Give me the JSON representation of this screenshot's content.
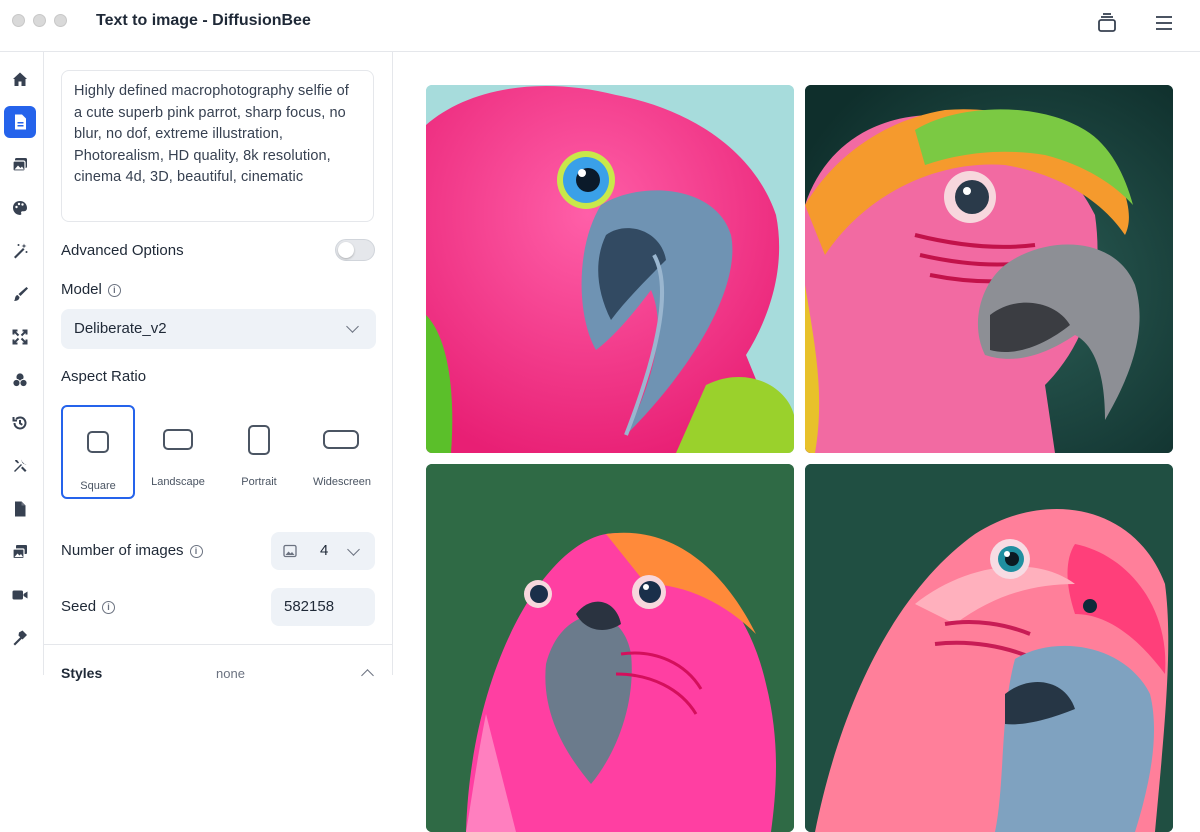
{
  "window": {
    "title": "Text to image - DiffusionBee"
  },
  "titlebar_icons": {
    "stack": "stack-icon",
    "menu": "hamburger-menu-icon"
  },
  "sidebar": {
    "items": [
      {
        "icon": "home-icon",
        "active": false
      },
      {
        "icon": "text-to-image-icon",
        "active": true
      },
      {
        "icon": "image-to-image-icon",
        "active": false
      },
      {
        "icon": "palette-icon",
        "active": false
      },
      {
        "icon": "magic-wand-icon",
        "active": false
      },
      {
        "icon": "brush-icon",
        "active": false
      },
      {
        "icon": "expand-icon",
        "active": false
      },
      {
        "icon": "models-icon",
        "active": false
      },
      {
        "icon": "history-icon",
        "active": false
      },
      {
        "icon": "tools-icon",
        "active": false
      },
      {
        "icon": "file-icon",
        "active": false
      },
      {
        "icon": "gallery-icon",
        "active": false
      },
      {
        "icon": "video-icon",
        "active": false
      },
      {
        "icon": "hammer-icon",
        "active": false
      }
    ],
    "accent": "#2563eb"
  },
  "panel": {
    "prompt": "Highly defined macrophotography selfie of a cute superb pink parrot, sharp focus, no blur, no dof, extreme illustration, Photorealism, HD quality, 8k resolution, cinema 4d, 3D, beautiful, cinematic",
    "advanced_label": "Advanced Options",
    "advanced_on": false,
    "model_label": "Model",
    "model_value": "Deliberate_v2",
    "aspect_label": "Aspect Ratio",
    "aspect_options": [
      "Square",
      "Landscape",
      "Portrait",
      "Widescreen"
    ],
    "aspect_selected": "Square",
    "num_images_label": "Number of images",
    "num_images_value": "4",
    "seed_label": "Seed",
    "seed_value": "582158",
    "styles_label": "Styles",
    "styles_value": "none"
  },
  "results": {
    "images": [
      {
        "subject": "pink parrot, light blue background",
        "background": "#9fd8d8"
      },
      {
        "subject": "pink parrot with green and orange crest, dark teal background",
        "background": "#1d4a44"
      },
      {
        "subject": "pink parrot, green background",
        "background": "#2f6a45"
      },
      {
        "subject": "pink parrot, dark teal background",
        "background": "#1f4f40"
      }
    ]
  }
}
